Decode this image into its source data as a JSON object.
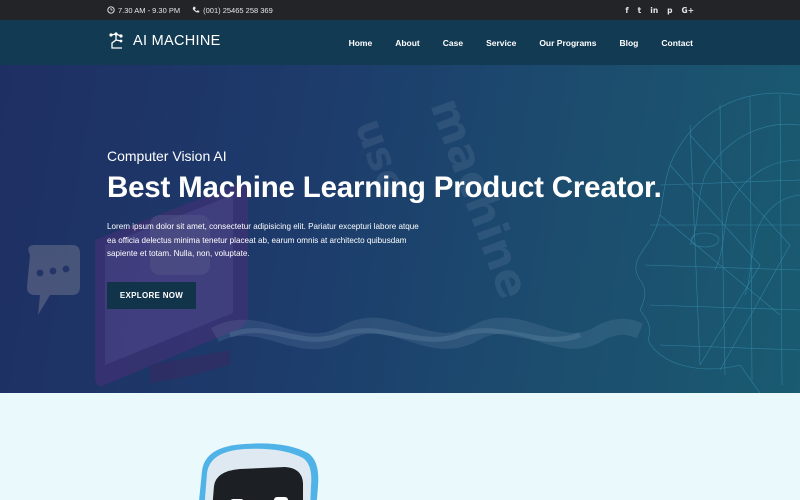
{
  "topbar": {
    "hours": "7.30 AM - 9.30 PM",
    "phone": "(001) 25465 258 369",
    "social": [
      {
        "icon": "facebook-icon",
        "glyph": "f"
      },
      {
        "icon": "twitter-icon",
        "glyph": "t"
      },
      {
        "icon": "linkedin-icon",
        "glyph": "in"
      },
      {
        "icon": "pinterest-icon",
        "glyph": "p"
      },
      {
        "icon": "google-plus-icon",
        "glyph": "G+"
      }
    ]
  },
  "header": {
    "logo_text": "AI MACHINE",
    "nav": [
      "Home",
      "About",
      "Case",
      "Service",
      "Our Programs",
      "Blog",
      "Contact"
    ]
  },
  "hero": {
    "eyebrow": "Computer Vision AI",
    "title": "Best Machine Learning Product Creator.",
    "description": "Lorem ipsum dolor sit amet, consectetur adipisicing elit. Pariatur excepturi labore atque ea officia delectus minima tenetur placeat ab, earum omnis at architecto quibusdam sapiente et totam. Nulla, non, voluptate.",
    "button_label": "EXPLORE NOW"
  },
  "colors": {
    "topbar_bg": "#222427",
    "header_bg": "#123a52",
    "button_bg": "#12344a",
    "section_bg": "#eaf9fc",
    "robot_accent": "#4fb3e8"
  }
}
